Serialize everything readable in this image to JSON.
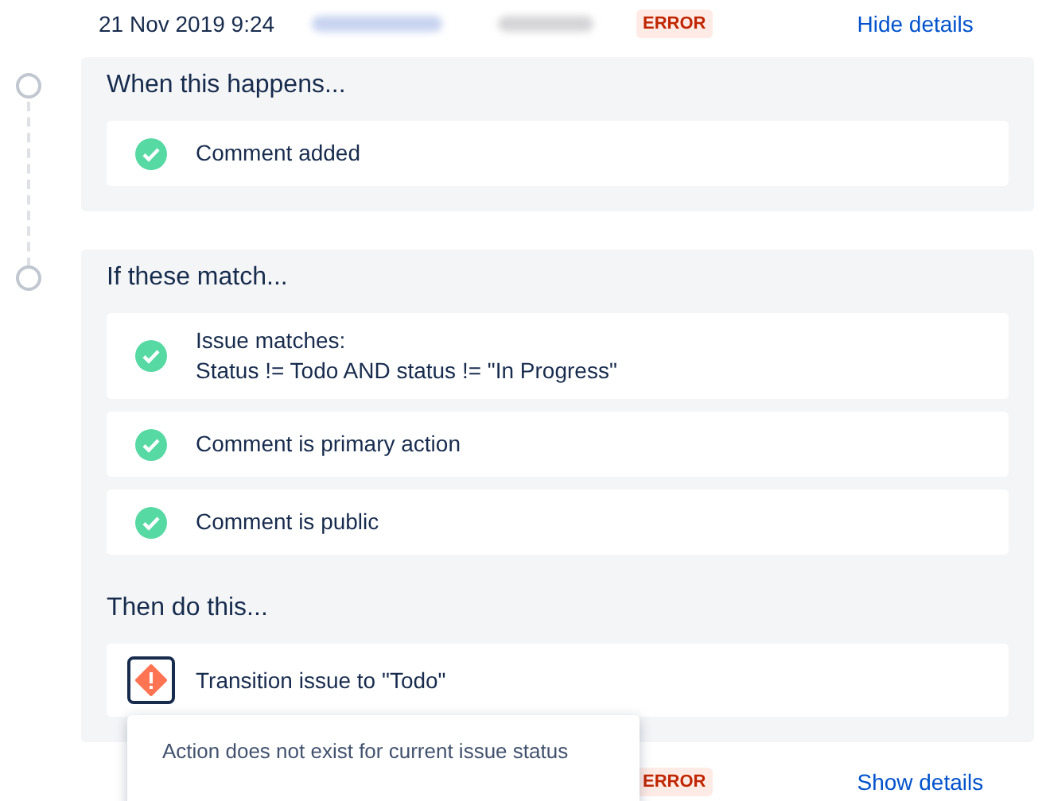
{
  "entries": [
    {
      "date": "21 Nov 2019 9:24",
      "status": "ERROR",
      "toggle": "Hide details"
    },
    {
      "status": "ERROR",
      "toggle": "Show details"
    }
  ],
  "trigger": {
    "heading": "When this happens...",
    "items": [
      {
        "kind": "success",
        "lines": [
          "Comment added"
        ]
      }
    ]
  },
  "conditions": {
    "heading": "If these match...",
    "items": [
      {
        "kind": "success",
        "lines": [
          "Issue matches:",
          "Status != Todo AND status != \"In Progress\""
        ]
      },
      {
        "kind": "success",
        "lines": [
          "Comment is primary action"
        ]
      },
      {
        "kind": "success",
        "lines": [
          "Comment is public"
        ]
      }
    ]
  },
  "actions": {
    "heading": "Then do this...",
    "items": [
      {
        "kind": "error",
        "selected": true,
        "lines": [
          "Transition issue to \"Todo\""
        ]
      }
    ]
  },
  "tooltip": "Action does not exist for current issue status"
}
